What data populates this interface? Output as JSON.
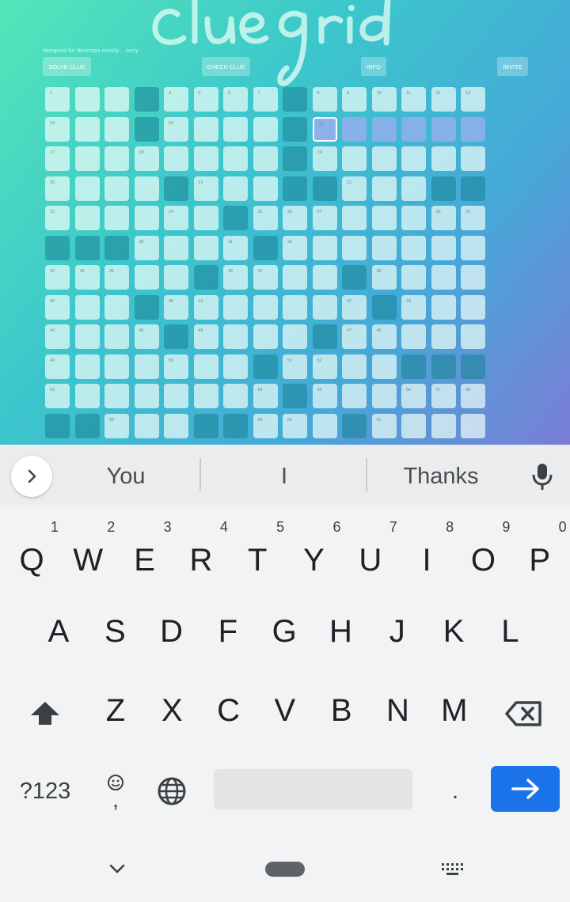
{
  "app": {
    "logo_text": "cluegrid",
    "tagline": "designed for desktops mostly... sorry",
    "buttons": [
      {
        "id": "solve",
        "label": "SOLVE CLUE"
      },
      {
        "id": "check",
        "label": "CHECK CLUE"
      },
      {
        "id": "info",
        "label": "INFO"
      },
      {
        "id": "invite",
        "label": "INVITE"
      }
    ],
    "selected_clue_number": 16,
    "grid_rows": [
      "1 . . # 4 5 6 7 # 8 9 10 11 12 13",
      "14 . . # 15 . . . # *16 ~ ~ ~ ~ ~",
      "17 . . 18 . . . . # 19 . . . . .",
      "20 . . . # 21 . . # # 22 . . # #",
      "23 . . . 24 . # 25 26 27 . . . 28 29",
      "# # # 30 . . 31 # 32 . . . . . .",
      "33 34 35 . . # 36 37 . . # 38 . . .",
      "39 . . # 40 41 . . . . 42 # 43 . .",
      "44 . . 45 # 46 . . . # 47 48 . . .",
      "49 . . . 50 . . # 51 52 . . # # #",
      "53 . . . . . . 54 # 55 . . 56 57 58",
      "# # 59 . . # # 60 61 . # 62 . . ."
    ],
    "colors": {
      "gradient_start": "#54e6b8",
      "gradient_end": "#7b7dd6",
      "highlight": "#96afee"
    }
  },
  "keyboard": {
    "suggestions": [
      "You",
      "I",
      "Thanks"
    ],
    "rows": [
      [
        {
          "k": "Q",
          "h": "1"
        },
        {
          "k": "W",
          "h": "2"
        },
        {
          "k": "E",
          "h": "3"
        },
        {
          "k": "R",
          "h": "4"
        },
        {
          "k": "T",
          "h": "5"
        },
        {
          "k": "Y",
          "h": "6"
        },
        {
          "k": "U",
          "h": "7"
        },
        {
          "k": "I",
          "h": "8"
        },
        {
          "k": "O",
          "h": "9"
        },
        {
          "k": "P",
          "h": "0"
        }
      ],
      [
        {
          "k": "A"
        },
        {
          "k": "S"
        },
        {
          "k": "D"
        },
        {
          "k": "F"
        },
        {
          "k": "G"
        },
        {
          "k": "H"
        },
        {
          "k": "J"
        },
        {
          "k": "K"
        },
        {
          "k": "L"
        }
      ],
      [
        {
          "k": "Z"
        },
        {
          "k": "X"
        },
        {
          "k": "C"
        },
        {
          "k": "V"
        },
        {
          "k": "B"
        },
        {
          "k": "N"
        },
        {
          "k": "M"
        }
      ]
    ],
    "symbols_label": "?123",
    "period_label": ".",
    "comma_label": ",",
    "icons": [
      "chevron-right-icon",
      "mic-icon",
      "shift-icon",
      "backspace-icon",
      "emoji-icon",
      "globe-icon",
      "arrow-right-icon",
      "chevron-down-icon",
      "home-pill-icon",
      "keyboard-icon"
    ]
  }
}
